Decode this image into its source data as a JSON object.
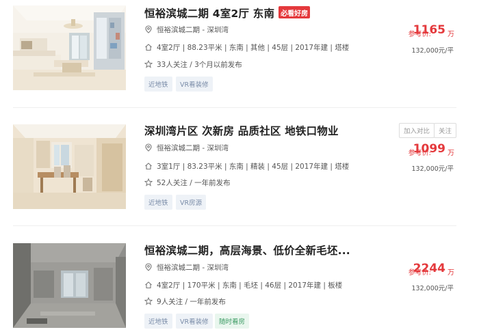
{
  "listings": [
    {
      "title": "恒裕滨城二期 4室2厅 东南",
      "badge": "必看好房",
      "location": "恒裕滨城二期 - 深圳湾",
      "info": "4室2厅 | 88.23平米 | 东南 | 其他 | 45层 | 2017年建 | 塔楼",
      "follow": "33人关注 / 3个月以前发布",
      "tags": [
        "近地铁",
        "VR看装修"
      ],
      "price_label": "参考价:",
      "price": "1165",
      "price_unit": "万",
      "unit_price": "132,000元/平"
    },
    {
      "title": "深圳湾片区 次新房 品质社区 地铁口物业",
      "location": "恒裕滨城二期 - 深圳湾",
      "info": "3室1厅 | 83.23平米 | 东南 | 精装 | 45层 | 2017年建 | 塔楼",
      "follow": "52人关注 / 一年前发布",
      "tags": [
        "近地铁",
        "VR房源"
      ],
      "compare_label": "加入对比",
      "follow_label": "关注",
      "price_label": "参考价:",
      "price": "1099",
      "price_unit": "万",
      "unit_price": "132,000元/平"
    },
    {
      "title": "恒裕滨城二期，高层海景、低价全新毛坯...",
      "location": "恒裕滨城二期 - 深圳湾",
      "info": "4室2厅 | 170平米 | 东南 | 毛坯 | 46层 | 2017年建 | 板楼",
      "follow": "9人关注 / 一年前发布",
      "tags": [
        "近地铁",
        "VR看装修",
        "随时看房"
      ],
      "price_label": "参考价:",
      "price": "2244",
      "price_unit": "万",
      "unit_price": "132,000元/平"
    }
  ]
}
